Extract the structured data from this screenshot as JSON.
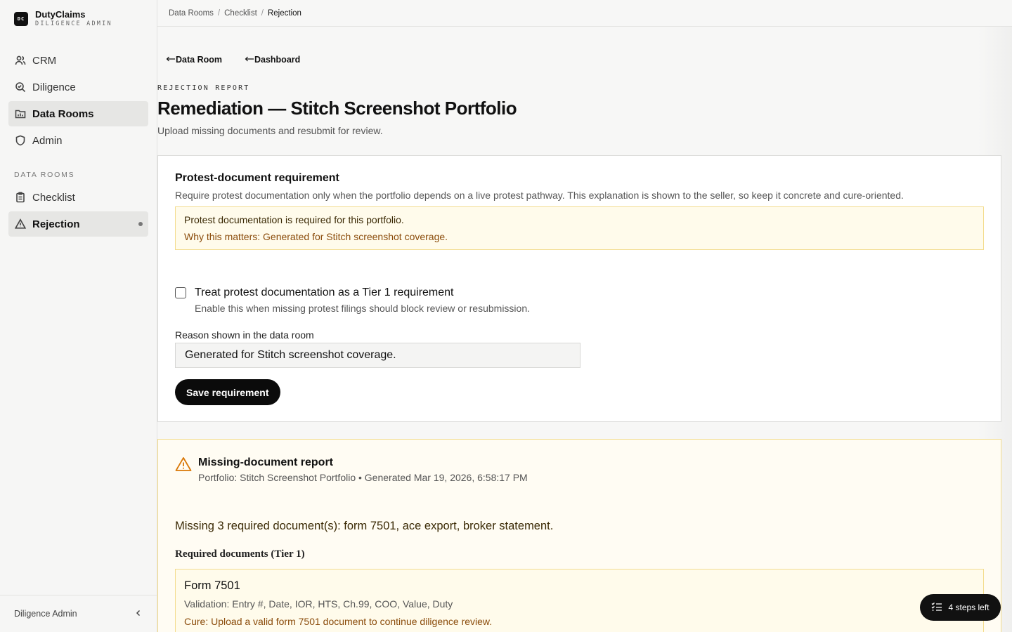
{
  "brand": {
    "logo_text": "DC",
    "name": "DutyClaims",
    "subtitle": "DILIGENCE ADMIN"
  },
  "nav": {
    "items": [
      {
        "label": "CRM",
        "icon": "users-icon"
      },
      {
        "label": "Diligence",
        "icon": "search-check-icon"
      },
      {
        "label": "Data Rooms",
        "icon": "folder-chart-icon",
        "active": true
      },
      {
        "label": "Admin",
        "icon": "shield-icon"
      }
    ],
    "section_label": "DATA ROOMS",
    "section_items": [
      {
        "label": "Checklist",
        "icon": "clipboard-icon"
      },
      {
        "label": "Rejection",
        "icon": "warning-icon",
        "active": true
      }
    ]
  },
  "footer": {
    "label": "Diligence Admin",
    "collapse_icon": "chevron-left-icon"
  },
  "breadcrumb": {
    "items": [
      "Data Rooms",
      "Checklist"
    ],
    "current": "Rejection"
  },
  "back_links": {
    "data_room": "Data Room",
    "dashboard": "Dashboard"
  },
  "header": {
    "eyebrow": "REJECTION REPORT",
    "title": "Remediation — Stitch Screenshot Portfolio",
    "subtitle": "Upload missing documents and resubmit for review."
  },
  "requirement": {
    "title": "Protest-document requirement",
    "description": "Require protest documentation only when the portfolio depends on a live protest pathway. This explanation is shown to the seller, so keep it concrete and cure-oriented.",
    "notice_line1": "Protest documentation is required for this portfolio.",
    "notice_line2": "Why this matters: Generated for Stitch screenshot coverage.",
    "checkbox_label": "Treat protest documentation as a Tier 1 requirement",
    "checkbox_hint": "Enable this when missing protest filings should block review or resubmission.",
    "checkbox_checked": false,
    "reason_label": "Reason shown in the data room",
    "reason_value": "Generated for Stitch screenshot coverage.",
    "save_label": "Save requirement"
  },
  "report": {
    "title": "Missing-document report",
    "meta": "Portfolio: Stitch Screenshot Portfolio • Generated Mar 19, 2026, 6:58:17 PM",
    "missing_summary": "Missing 3 required document(s): form 7501, ace export, broker statement.",
    "section_title": "Required documents (Tier 1)",
    "documents": [
      {
        "name": "Form 7501",
        "validation": "Validation: Entry #, Date, IOR, HTS, Ch.99, COO, Value, Duty",
        "cure": "Cure: Upload a valid form 7501 document to continue diligence review."
      }
    ]
  },
  "steps_pill": {
    "label": "4 steps left",
    "icon": "checklist-icon"
  },
  "colors": {
    "accent": "#0b0b0b",
    "warning_bg": "#fffbeb",
    "warning_border": "#f3dc8e",
    "warning_text": "#8a4b0a",
    "warning_icon": "#d97706"
  }
}
